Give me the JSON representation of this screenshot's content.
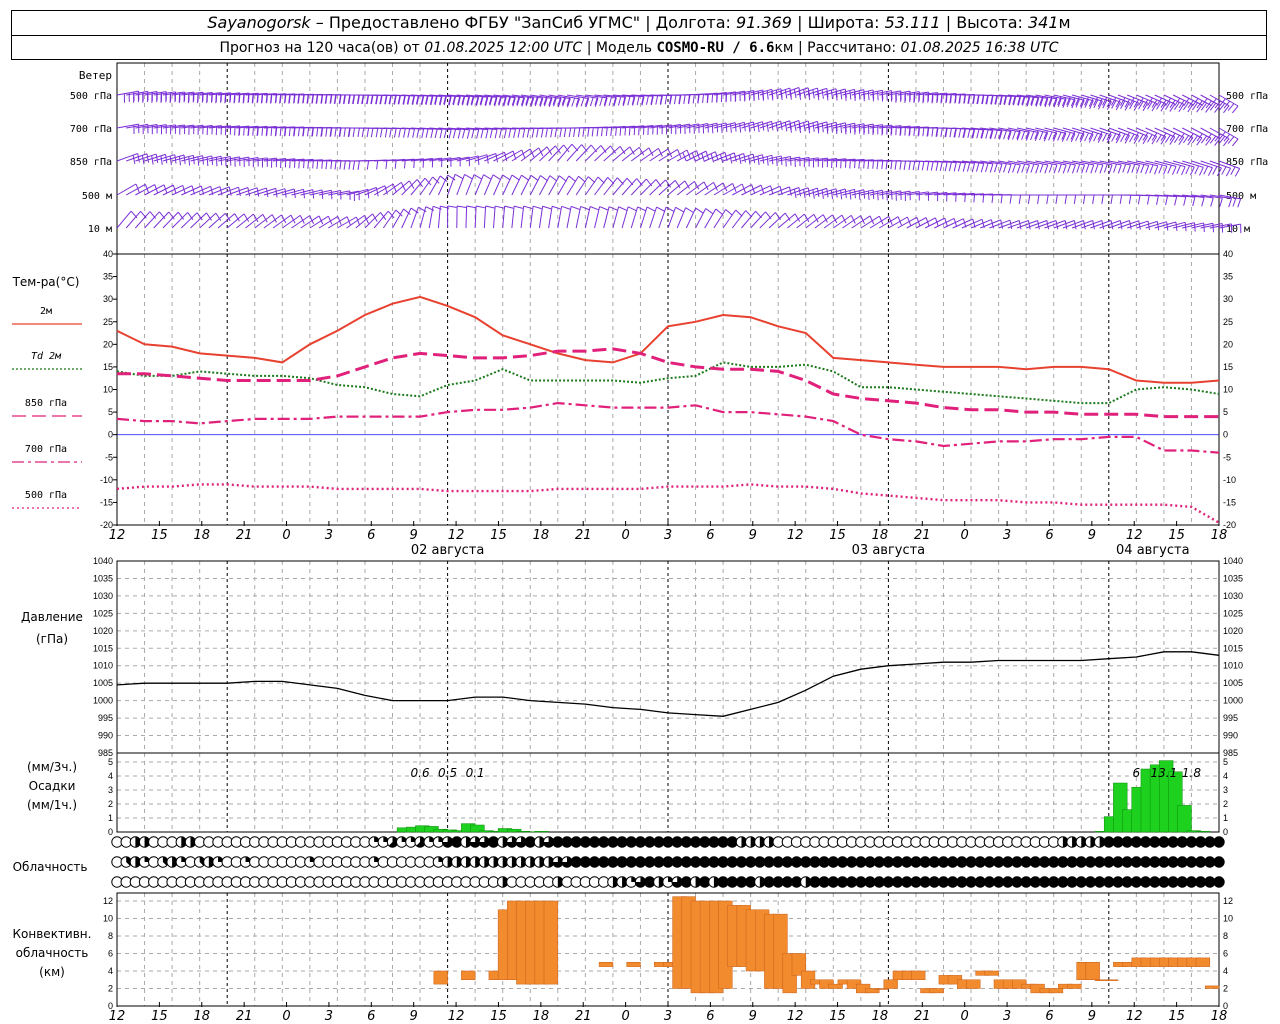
{
  "header": {
    "station": "Sayanogorsk",
    "provider": "Предоставлено ФГБУ \"ЗапСиб УГМС\"",
    "lon_label": "Долгота:",
    "lon": "91.369",
    "lat_label": "Широта:",
    "lat": "53.111",
    "alt_label": "Высота:",
    "alt": "341",
    "alt_unit": "м",
    "forecast_label": "Прогноз на 120 часа(ов) от",
    "forecast_start": "01.08.2025 12:00 UTC",
    "model_label": "Модель",
    "model": "COSMO-RU / 6.6",
    "model_unit": "км",
    "computed_label": "Рассчитано:",
    "computed": "01.08.2025 16:38 UTC"
  },
  "wind_panel": {
    "title": "Ветер",
    "levels": [
      "500 гПа",
      "700 гПа",
      "850 гПа",
      "500 м",
      "10 м"
    ]
  },
  "temp_panel": {
    "title": "Тем-ра(°C)",
    "legend": [
      {
        "label": "2м",
        "color": "#e8412f"
      },
      {
        "label": "Td  2м",
        "color": "#1a7a1a"
      },
      {
        "label": "850 гПа",
        "color": "#e0207a"
      },
      {
        "label": "700 гПа",
        "color": "#e0207a"
      },
      {
        "label": "500 гПа",
        "color": "#e0207a"
      }
    ],
    "yticks": [
      "40",
      "35",
      "30",
      "25",
      "20",
      "15",
      "10",
      "5",
      "0",
      "-5",
      "-10",
      "-15",
      "-20"
    ]
  },
  "time_axis": {
    "hour_labels": [
      "12",
      "15",
      "18",
      "21",
      "0",
      "3",
      "6",
      "9",
      "12",
      "15",
      "18",
      "21",
      "0",
      "3",
      "6",
      "9",
      "12",
      "15",
      "18",
      "21",
      "0",
      "3",
      "6",
      "9",
      "12",
      "15",
      "18"
    ],
    "dates": [
      "02 августа",
      "03 августа",
      "04 августа"
    ]
  },
  "pressure_panel": {
    "title": "Давление",
    "unit": "(гПа)",
    "yticks": [
      "1040",
      "1035",
      "1030",
      "1025",
      "1020",
      "1015",
      "1010",
      "1005",
      "1000",
      "995",
      "990",
      "985"
    ]
  },
  "precip_panel": {
    "unit1": "(мм/3ч.)",
    "title": "Осадки",
    "unit2": "(мм/1ч.)",
    "yticks": [
      "5",
      "4",
      "3",
      "2",
      "1",
      "0"
    ],
    "labels": [
      {
        "h": 33,
        "text": "0.6"
      },
      {
        "h": 36,
        "text": "0.5"
      },
      {
        "h": 39,
        "text": "0.1"
      },
      {
        "h": 111,
        "text": "6"
      },
      {
        "h": 114,
        "text": "13.1"
      },
      {
        "h": 117,
        "text": "1.8"
      }
    ]
  },
  "cloud_panel": {
    "title": "Облачность"
  },
  "conv_panel": {
    "title1": "Конвективн.",
    "title2": "облачность",
    "unit": "(км)",
    "yticks": [
      "12",
      "10",
      "8",
      "6",
      "4",
      "2",
      "0"
    ]
  },
  "chart_data": [
    {
      "type": "line",
      "title": "Ветер",
      "levels": [
        "500 гПа",
        "700 гПа",
        "850 гПа",
        "500 м",
        "10 м"
      ],
      "x": [
        0,
        12,
        24,
        36,
        48,
        60,
        72,
        84,
        96,
        108,
        120
      ],
      "series": [
        {
          "name": "500 гПа",
          "dir": [
            260,
            265,
            270,
            275,
            280,
            270,
            250,
            260,
            275,
            290,
            300
          ],
          "speed": [
            35,
            40,
            45,
            40,
            35,
            30,
            30,
            35,
            40,
            45,
            45
          ]
        },
        {
          "name": "700 гПа",
          "dir": [
            260,
            265,
            270,
            275,
            270,
            260,
            250,
            265,
            280,
            290,
            300
          ],
          "speed": [
            20,
            25,
            25,
            20,
            15,
            20,
            25,
            25,
            30,
            30,
            35
          ]
        },
        {
          "name": "850 гПа",
          "dir": [
            250,
            260,
            270,
            260,
            220,
            240,
            260,
            270,
            280,
            280,
            290
          ],
          "speed": [
            15,
            15,
            15,
            10,
            10,
            15,
            20,
            20,
            15,
            15,
            20
          ]
        },
        {
          "name": "500 м",
          "dir": [
            240,
            250,
            260,
            200,
            210,
            230,
            250,
            260,
            270,
            270,
            280
          ],
          "speed": [
            10,
            10,
            15,
            10,
            10,
            10,
            15,
            15,
            10,
            10,
            15
          ]
        },
        {
          "name": "10 м",
          "dir": [
            220,
            230,
            240,
            180,
            190,
            200,
            230,
            240,
            250,
            250,
            260
          ],
          "speed": [
            5,
            5,
            10,
            5,
            5,
            5,
            10,
            10,
            5,
            5,
            5
          ]
        }
      ]
    },
    {
      "type": "line",
      "title": "Тем-ра(°C)",
      "ylim": [
        -20,
        40
      ],
      "xlabel": "",
      "ylabel": "Тем-ра(°C)",
      "x": [
        0,
        3,
        6,
        9,
        12,
        15,
        18,
        21,
        24,
        27,
        30,
        33,
        36,
        39,
        42,
        45,
        48,
        51,
        54,
        57,
        60,
        63,
        66,
        69,
        72,
        75,
        78,
        81,
        84,
        87,
        90,
        93,
        96,
        99,
        102,
        105,
        108,
        111,
        114,
        117,
        120
      ],
      "series": [
        {
          "name": "2м",
          "values": [
            23,
            20,
            19.5,
            18,
            17.5,
            17,
            16,
            20,
            23,
            26.5,
            29,
            30.5,
            28.5,
            26,
            22,
            20,
            18,
            16.5,
            16,
            18,
            24,
            25,
            26.5,
            26,
            24,
            22.5,
            17,
            16.5,
            16,
            15.5,
            15,
            15,
            15,
            14.5,
            15,
            15,
            14.5,
            12,
            11.5,
            11.5,
            12
          ]
        },
        {
          "name": "Td  2м",
          "values": [
            14,
            13,
            13,
            14,
            13.5,
            13,
            13,
            12.5,
            11,
            10.5,
            9,
            8.5,
            11,
            12,
            14.5,
            12,
            12,
            12,
            12,
            11.5,
            12.5,
            13,
            16,
            15,
            15,
            15.5,
            14,
            10.5,
            10.5,
            10,
            9.5,
            9,
            8.5,
            8,
            7.5,
            7,
            7,
            10,
            10.5,
            10,
            9
          ]
        },
        {
          "name": "850 гПа",
          "values": [
            13.5,
            13.5,
            13,
            12.5,
            12,
            12,
            12,
            12,
            13,
            15,
            17,
            18,
            17.5,
            17,
            17,
            17.5,
            18.5,
            18.5,
            19,
            18,
            16,
            15,
            14.5,
            14.5,
            14,
            12,
            9,
            8,
            7.5,
            7,
            6,
            5.5,
            5.5,
            5,
            5,
            4.5,
            4.5,
            4.5,
            4,
            4,
            4
          ]
        },
        {
          "name": "700 гПа",
          "values": [
            3.5,
            3,
            3,
            2.5,
            3,
            3.5,
            3.5,
            3.5,
            4,
            4,
            4,
            4,
            5,
            5.5,
            5.5,
            6,
            7,
            6.5,
            6,
            6,
            6,
            6.5,
            5,
            5,
            4.5,
            4,
            3,
            0,
            -1,
            -1.5,
            -2.5,
            -2,
            -1.5,
            -1.5,
            -1,
            -1,
            -0.5,
            -0.5,
            -3.5,
            -3.5,
            -4
          ]
        },
        {
          "name": "500 гПа",
          "values": [
            -12,
            -11.5,
            -11.5,
            -11,
            -11,
            -11.5,
            -11.5,
            -11.5,
            -12,
            -12,
            -12,
            -12,
            -12.5,
            -12.5,
            -12.5,
            -12.5,
            -12,
            -12,
            -12,
            -12,
            -11.5,
            -11.5,
            -11.5,
            -11,
            -11.5,
            -11.5,
            -12,
            -13,
            -13.5,
            -14,
            -14.5,
            -14.5,
            -14.5,
            -15,
            -15,
            -15.5,
            -15.5,
            -15.5,
            -15.5,
            -16,
            -19.5
          ]
        }
      ]
    },
    {
      "type": "line",
      "title": "Давление",
      "ylim": [
        985,
        1040
      ],
      "xlabel": "",
      "ylabel": "(гПа)",
      "x": [
        0,
        3,
        6,
        9,
        12,
        15,
        18,
        21,
        24,
        27,
        30,
        33,
        36,
        39,
        42,
        45,
        48,
        51,
        54,
        57,
        60,
        63,
        66,
        69,
        72,
        75,
        78,
        81,
        84,
        87,
        90,
        93,
        96,
        99,
        102,
        105,
        108,
        111,
        114,
        117,
        120
      ],
      "series": [
        {
          "name": "Давление",
          "values": [
            1004.5,
            1005,
            1005,
            1005,
            1005,
            1005.5,
            1005.5,
            1004.5,
            1003.5,
            1001.5,
            1000,
            1000,
            1000,
            1001,
            1001,
            1000,
            999.5,
            999,
            998,
            997.5,
            996.5,
            996,
            995.5,
            997.5,
            999.5,
            1003,
            1007,
            1009,
            1010,
            1010.5,
            1011,
            1011,
            1011.5,
            1011.5,
            1011.5,
            1011.5,
            1012,
            1012.5,
            1014,
            1014,
            1013
          ]
        }
      ]
    },
    {
      "type": "bar",
      "title": "Осадки",
      "ylim": [
        0,
        5
      ],
      "ylabel": "(мм/1ч.)",
      "x": [
        32,
        33,
        34,
        35,
        36,
        37,
        38,
        39,
        40,
        41,
        42,
        43,
        44,
        45,
        46,
        47,
        108,
        109,
        110,
        111,
        112,
        113,
        114,
        115,
        116,
        117,
        118,
        119,
        120
      ],
      "values": [
        0.3,
        0.35,
        0.45,
        0.4,
        0.2,
        0.15,
        0.1,
        0.6,
        0.5,
        0.1,
        0.05,
        0.25,
        0.2,
        0.05,
        0.02,
        0.05,
        0.05,
        1.1,
        3.5,
        1.6,
        3.2,
        4.5,
        4.8,
        5.1,
        4.3,
        1.9,
        0.1,
        0.05,
        0
      ]
    },
    {
      "type": "bar",
      "title": "Конвективн. облачность",
      "ylim": [
        0,
        13
      ],
      "ylabel": "(км)",
      "x": [
        36,
        39,
        42,
        43,
        44,
        45,
        46,
        47,
        48,
        54,
        57,
        60,
        61,
        62,
        63,
        64,
        65,
        66,
        67,
        68,
        69,
        70,
        71,
        72,
        73,
        74,
        75,
        76,
        77,
        78,
        79,
        80,
        81,
        82,
        83,
        84,
        85,
        86,
        87,
        88,
        89,
        90,
        91,
        92,
        93,
        94,
        95,
        96,
        97,
        98,
        99,
        100,
        101,
        102,
        103,
        104,
        105,
        106,
        107,
        108,
        109,
        110,
        111,
        112,
        113,
        114,
        115,
        116,
        117,
        118,
        119,
        120
      ],
      "bottom": [
        2.5,
        3,
        3,
        3,
        3,
        2.5,
        2.5,
        2.5,
        2.5,
        4.5,
        4.5,
        4.5,
        4.5,
        2,
        2,
        1.5,
        1.5,
        1.5,
        2,
        4.5,
        4.5,
        4,
        4,
        2,
        2,
        1.5,
        3.5,
        2,
        2.5,
        2,
        2,
        2.5,
        2,
        1.5,
        1.5,
        2,
        2,
        3,
        3,
        3,
        1.5,
        1.5,
        2.5,
        2.5,
        2,
        2,
        3.5,
        3.5,
        2,
        2,
        2,
        2,
        1.5,
        1.5,
        1.5,
        2,
        2,
        3,
        3,
        4.5,
        4.5,
        4.5,
        4.5,
        4.5,
        4.5,
        4.5,
        4.5,
        4.5,
        4.5,
        4.5,
        4.5,
        2
      ],
      "top": [
        4,
        4,
        4,
        11,
        12,
        12,
        12,
        12,
        12,
        5,
        5,
        5,
        5,
        12.5,
        12.5,
        12,
        12,
        12,
        12,
        11.5,
        11.5,
        11,
        11,
        10.5,
        10.5,
        6,
        6,
        4,
        3,
        3,
        2.5,
        3,
        3,
        2.5,
        2,
        2,
        3,
        4,
        4,
        4,
        2,
        2,
        3.5,
        3.5,
        3,
        3,
        4,
        4,
        3,
        3,
        3,
        2.5,
        2.5,
        2,
        2,
        2.5,
        2.5,
        5,
        5,
        3,
        3,
        5,
        5,
        5.5,
        5.5,
        5.5,
        5.5,
        5.5,
        5.5,
        5.5,
        5.5,
        2.3
      ]
    }
  ]
}
